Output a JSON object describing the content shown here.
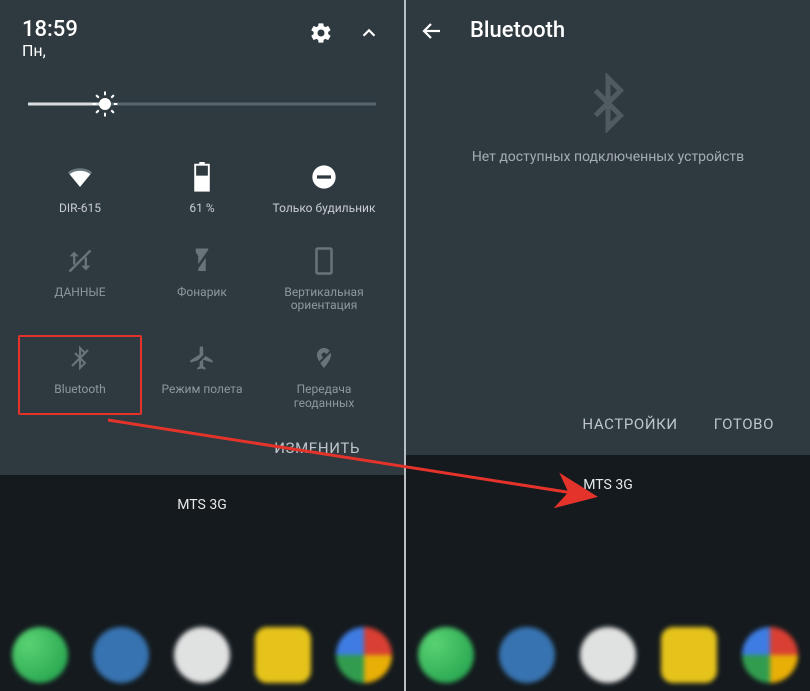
{
  "left": {
    "time": "18:59",
    "day": "Пн,",
    "brightness_pct": 22,
    "tiles": [
      {
        "id": "wifi",
        "label": "DIR-615",
        "active": true
      },
      {
        "id": "battery",
        "label": "61 %",
        "active": true
      },
      {
        "id": "dnd",
        "label": "Только будильник",
        "active": true
      },
      {
        "id": "data",
        "label": "ДАННЫЕ",
        "active": false
      },
      {
        "id": "flashlight",
        "label": "Фонарик",
        "active": false
      },
      {
        "id": "rotation",
        "label": "Вертикальная ориентация",
        "active": false
      },
      {
        "id": "bluetooth",
        "label": "Bluetooth",
        "active": false,
        "highlighted": true
      },
      {
        "id": "airplane",
        "label": "Режим полета",
        "active": false
      },
      {
        "id": "location",
        "label": "Передача геоданных",
        "active": false
      }
    ],
    "edit_label": "ИЗМЕНИТЬ",
    "carrier": "MTS 3G"
  },
  "right": {
    "title": "Bluetooth",
    "empty_message": "Нет доступных подключенных устройств",
    "actions": {
      "settings": "НАСТРОЙКИ",
      "done": "ГОТОВО"
    },
    "carrier": "MTS 3G"
  },
  "colors": {
    "highlight": "#e4332a",
    "panel": "#2f3a40"
  }
}
